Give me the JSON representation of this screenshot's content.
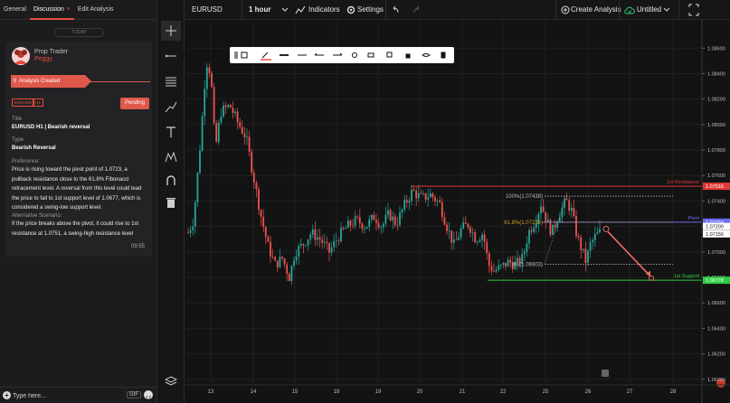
{
  "tabs": [
    {
      "label": "General"
    },
    {
      "label": "Discussion",
      "close": "×"
    },
    {
      "label": "Edit Analysis"
    }
  ],
  "timeline": {
    "today_label": "TODAY"
  },
  "post": {
    "author_role": "Prop Trader",
    "author_name": "Peggy",
    "status": "Analysis Created",
    "tags": [
      "EURUSD",
      "H1"
    ],
    "pending_label": "Pending",
    "title_label": "Title",
    "title": "EURUSD H1 | Bearish reversal",
    "type_label": "Type",
    "type": "Bearish Reversal",
    "preference_label": "Preference:",
    "preference": "Price is rising toward the pivot point of 1.0723, a pullback resistance close to the 61.8% Fibonacci retracement level. A reversal from this level could lead the price to fall to 1st  support level of 1.0677, which is considered a swing-low support level.",
    "alt_label": "Alternative Scenario:",
    "alt": "If the price breaks above the pivot, it could rise to 1st resistance at 1.0751, a swing-high resistance level",
    "time": "09:55"
  },
  "chat": {
    "placeholder": "Type here...",
    "gif_label": "GIF"
  },
  "toolbar": {
    "symbol": "EURUSD",
    "interval": "1 hour",
    "indicators_label": "Indicators",
    "settings_label": "Settings",
    "create_label": "Create Analysis",
    "layout_name": "Untitled"
  },
  "colors": {
    "accent": "#e74c3c",
    "up": "#26a69a",
    "down": "#ef5350",
    "resistance": "#e53935",
    "support": "#2ecc40",
    "pivot": "#6c6cf0"
  },
  "chart_data": {
    "type": "candlestick",
    "symbol": "EURUSD",
    "interval": "1 hour",
    "x_ticks": [
      "13",
      "14",
      "15",
      "18",
      "19",
      "20",
      "21",
      "22",
      "25",
      "26",
      "27",
      "28"
    ],
    "y_ticks": [
      "1.08600",
      "1.08400",
      "1.08200",
      "1.08000",
      "1.07800",
      "1.07600",
      "1.07400",
      "1.07200",
      "1.07000",
      "1.06800",
      "1.06600",
      "1.06400",
      "1.06200",
      "1.06000"
    ],
    "ylim": [
      1.0597,
      1.0868
    ],
    "levels": [
      {
        "name": "1st Resistance",
        "value": 1.07516,
        "price_tag": "1.07516",
        "color": "#e53935"
      },
      {
        "name": "Pivot",
        "value": 1.07234,
        "price_tag": "1.07234",
        "color": "#6c6cf0"
      },
      {
        "name": "1st Support",
        "value": 1.06778,
        "price_tag": "1.06778",
        "color": "#2ecc40"
      }
    ],
    "current_price_tags": [
      "1.07200",
      "1.07156"
    ],
    "fibonacci": [
      {
        "label": "100%(1.07438)",
        "value": 1.07438
      },
      {
        "label": "61.8%(1.07233)",
        "value": 1.07233
      },
      {
        "label": "0%(1.06903)",
        "value": 1.06903
      }
    ],
    "forecast_arrow": {
      "from": 1.0718,
      "to": 1.06795
    }
  }
}
